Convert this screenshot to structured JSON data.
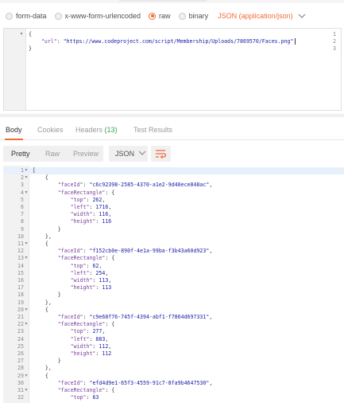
{
  "body_types": {
    "options": [
      {
        "label": "form-data",
        "selected": false
      },
      {
        "label": "x-www-form-urlencoded",
        "selected": false
      },
      {
        "label": "raw",
        "selected": true
      },
      {
        "label": "binary",
        "selected": false
      }
    ],
    "content_type": "JSON (application/json)",
    "accent_color": "#f26b3a"
  },
  "request_body": {
    "lines": [
      {
        "n": "1",
        "parts": [
          [
            "pun",
            "{"
          ]
        ],
        "fold": "▾"
      },
      {
        "n": "2",
        "parts": [
          [
            "pun",
            "    "
          ],
          [
            "key",
            "\"url\""
          ],
          [
            "pun",
            ": "
          ],
          [
            "str",
            "\"https://www.codeproject.com/script/Membership/Uploads/7869570/Faces.png\""
          ]
        ],
        "caret": true
      },
      {
        "n": "3",
        "parts": [
          [
            "pun",
            "}"
          ]
        ]
      }
    ]
  },
  "response_tabs": {
    "tabs": [
      {
        "label": "Body",
        "active": true
      },
      {
        "label": "Cookies",
        "active": false
      },
      {
        "label": "Headers",
        "count": "(13)",
        "active": false
      },
      {
        "label": "Test Results",
        "active": false
      }
    ]
  },
  "view_modes": {
    "modes": [
      {
        "label": "Pretty",
        "active": true
      },
      {
        "label": "Raw",
        "active": false
      },
      {
        "label": "Preview",
        "active": false
      }
    ],
    "format": "JSON",
    "wrap_icon": "wrap-lines-icon"
  },
  "response_body": {
    "lines": [
      {
        "n": "1",
        "fold": "▾",
        "parts": [
          [
            "pun",
            "["
          ]
        ]
      },
      {
        "n": "2",
        "fold": "▾",
        "parts": [
          [
            "pun",
            "    {"
          ]
        ]
      },
      {
        "n": "3",
        "parts": [
          [
            "pun",
            "        "
          ],
          [
            "key",
            "\"faceId\""
          ],
          [
            "pun",
            ": "
          ],
          [
            "str",
            "\"c6c92398-2585-4370-a1e2-9d40ece848ac\""
          ],
          [
            "pun",
            ","
          ]
        ]
      },
      {
        "n": "4",
        "fold": "▾",
        "parts": [
          [
            "pun",
            "        "
          ],
          [
            "key",
            "\"faceRectangle\""
          ],
          [
            "pun",
            ": {"
          ]
        ]
      },
      {
        "n": "5",
        "parts": [
          [
            "pun",
            "            "
          ],
          [
            "key",
            "\"top\""
          ],
          [
            "pun",
            ": "
          ],
          [
            "num",
            "262"
          ],
          [
            "pun",
            ","
          ]
        ]
      },
      {
        "n": "6",
        "parts": [
          [
            "pun",
            "            "
          ],
          [
            "key",
            "\"left\""
          ],
          [
            "pun",
            ": "
          ],
          [
            "num",
            "1716"
          ],
          [
            "pun",
            ","
          ]
        ]
      },
      {
        "n": "7",
        "parts": [
          [
            "pun",
            "            "
          ],
          [
            "key",
            "\"width\""
          ],
          [
            "pun",
            ": "
          ],
          [
            "num",
            "116"
          ],
          [
            "pun",
            ","
          ]
        ]
      },
      {
        "n": "8",
        "parts": [
          [
            "pun",
            "            "
          ],
          [
            "key",
            "\"height\""
          ],
          [
            "pun",
            ": "
          ],
          [
            "num",
            "116"
          ]
        ]
      },
      {
        "n": "9",
        "parts": [
          [
            "pun",
            "        }"
          ]
        ]
      },
      {
        "n": "10",
        "parts": [
          [
            "pun",
            "    },"
          ]
        ]
      },
      {
        "n": "11",
        "fold": "▾",
        "parts": [
          [
            "pun",
            "    {"
          ]
        ]
      },
      {
        "n": "12",
        "parts": [
          [
            "pun",
            "        "
          ],
          [
            "key",
            "\"faceId\""
          ],
          [
            "pun",
            ": "
          ],
          [
            "str",
            "\"f152cb0e-890f-4e1a-99ba-f3b43a60d923\""
          ],
          [
            "pun",
            ","
          ]
        ]
      },
      {
        "n": "13",
        "fold": "▾",
        "parts": [
          [
            "pun",
            "        "
          ],
          [
            "key",
            "\"faceRectangle\""
          ],
          [
            "pun",
            ": {"
          ]
        ]
      },
      {
        "n": "14",
        "parts": [
          [
            "pun",
            "            "
          ],
          [
            "key",
            "\"top\""
          ],
          [
            "pun",
            ": "
          ],
          [
            "num",
            "62"
          ],
          [
            "pun",
            ","
          ]
        ]
      },
      {
        "n": "15",
        "parts": [
          [
            "pun",
            "            "
          ],
          [
            "key",
            "\"left\""
          ],
          [
            "pun",
            ": "
          ],
          [
            "num",
            "254"
          ],
          [
            "pun",
            ","
          ]
        ]
      },
      {
        "n": "16",
        "parts": [
          [
            "pun",
            "            "
          ],
          [
            "key",
            "\"width\""
          ],
          [
            "pun",
            ": "
          ],
          [
            "num",
            "113"
          ],
          [
            "pun",
            ","
          ]
        ]
      },
      {
        "n": "17",
        "parts": [
          [
            "pun",
            "            "
          ],
          [
            "key",
            "\"height\""
          ],
          [
            "pun",
            ": "
          ],
          [
            "num",
            "113"
          ]
        ]
      },
      {
        "n": "18",
        "parts": [
          [
            "pun",
            "        }"
          ]
        ]
      },
      {
        "n": "19",
        "parts": [
          [
            "pun",
            "    },"
          ]
        ]
      },
      {
        "n": "20",
        "fold": "▾",
        "parts": [
          [
            "pun",
            "    {"
          ]
        ]
      },
      {
        "n": "21",
        "parts": [
          [
            "pun",
            "        "
          ],
          [
            "key",
            "\"faceId\""
          ],
          [
            "pun",
            ": "
          ],
          [
            "str",
            "\"c9e68f76-745f-4394-abf1-f7864d697331\""
          ],
          [
            "pun",
            ","
          ]
        ]
      },
      {
        "n": "22",
        "fold": "▾",
        "parts": [
          [
            "pun",
            "        "
          ],
          [
            "key",
            "\"faceRectangle\""
          ],
          [
            "pun",
            ": {"
          ]
        ]
      },
      {
        "n": "23",
        "parts": [
          [
            "pun",
            "            "
          ],
          [
            "key",
            "\"top\""
          ],
          [
            "pun",
            ": "
          ],
          [
            "num",
            "277"
          ],
          [
            "pun",
            ","
          ]
        ]
      },
      {
        "n": "24",
        "parts": [
          [
            "pun",
            "            "
          ],
          [
            "key",
            "\"left\""
          ],
          [
            "pun",
            ": "
          ],
          [
            "num",
            "883"
          ],
          [
            "pun",
            ","
          ]
        ]
      },
      {
        "n": "25",
        "parts": [
          [
            "pun",
            "            "
          ],
          [
            "key",
            "\"width\""
          ],
          [
            "pun",
            ": "
          ],
          [
            "num",
            "112"
          ],
          [
            "pun",
            ","
          ]
        ]
      },
      {
        "n": "26",
        "parts": [
          [
            "pun",
            "            "
          ],
          [
            "key",
            "\"height\""
          ],
          [
            "pun",
            ": "
          ],
          [
            "num",
            "112"
          ]
        ]
      },
      {
        "n": "27",
        "parts": [
          [
            "pun",
            "        }"
          ]
        ]
      },
      {
        "n": "28",
        "parts": [
          [
            "pun",
            "    },"
          ]
        ]
      },
      {
        "n": "29",
        "fold": "▾",
        "parts": [
          [
            "pun",
            "    {"
          ]
        ]
      },
      {
        "n": "30",
        "parts": [
          [
            "pun",
            "        "
          ],
          [
            "key",
            "\"faceId\""
          ],
          [
            "pun",
            ": "
          ],
          [
            "str",
            "\"efd4d9e1-65f3-4559-91c7-8fa9b4647530\""
          ],
          [
            "pun",
            ","
          ]
        ]
      },
      {
        "n": "31",
        "fold": "▾",
        "parts": [
          [
            "pun",
            "        "
          ],
          [
            "key",
            "\"faceRectangle\""
          ],
          [
            "pun",
            ": {"
          ]
        ]
      },
      {
        "n": "32",
        "parts": [
          [
            "pun",
            "            "
          ],
          [
            "key",
            "\"top\""
          ],
          [
            "pun",
            ": "
          ],
          [
            "num",
            "63"
          ]
        ]
      }
    ]
  }
}
